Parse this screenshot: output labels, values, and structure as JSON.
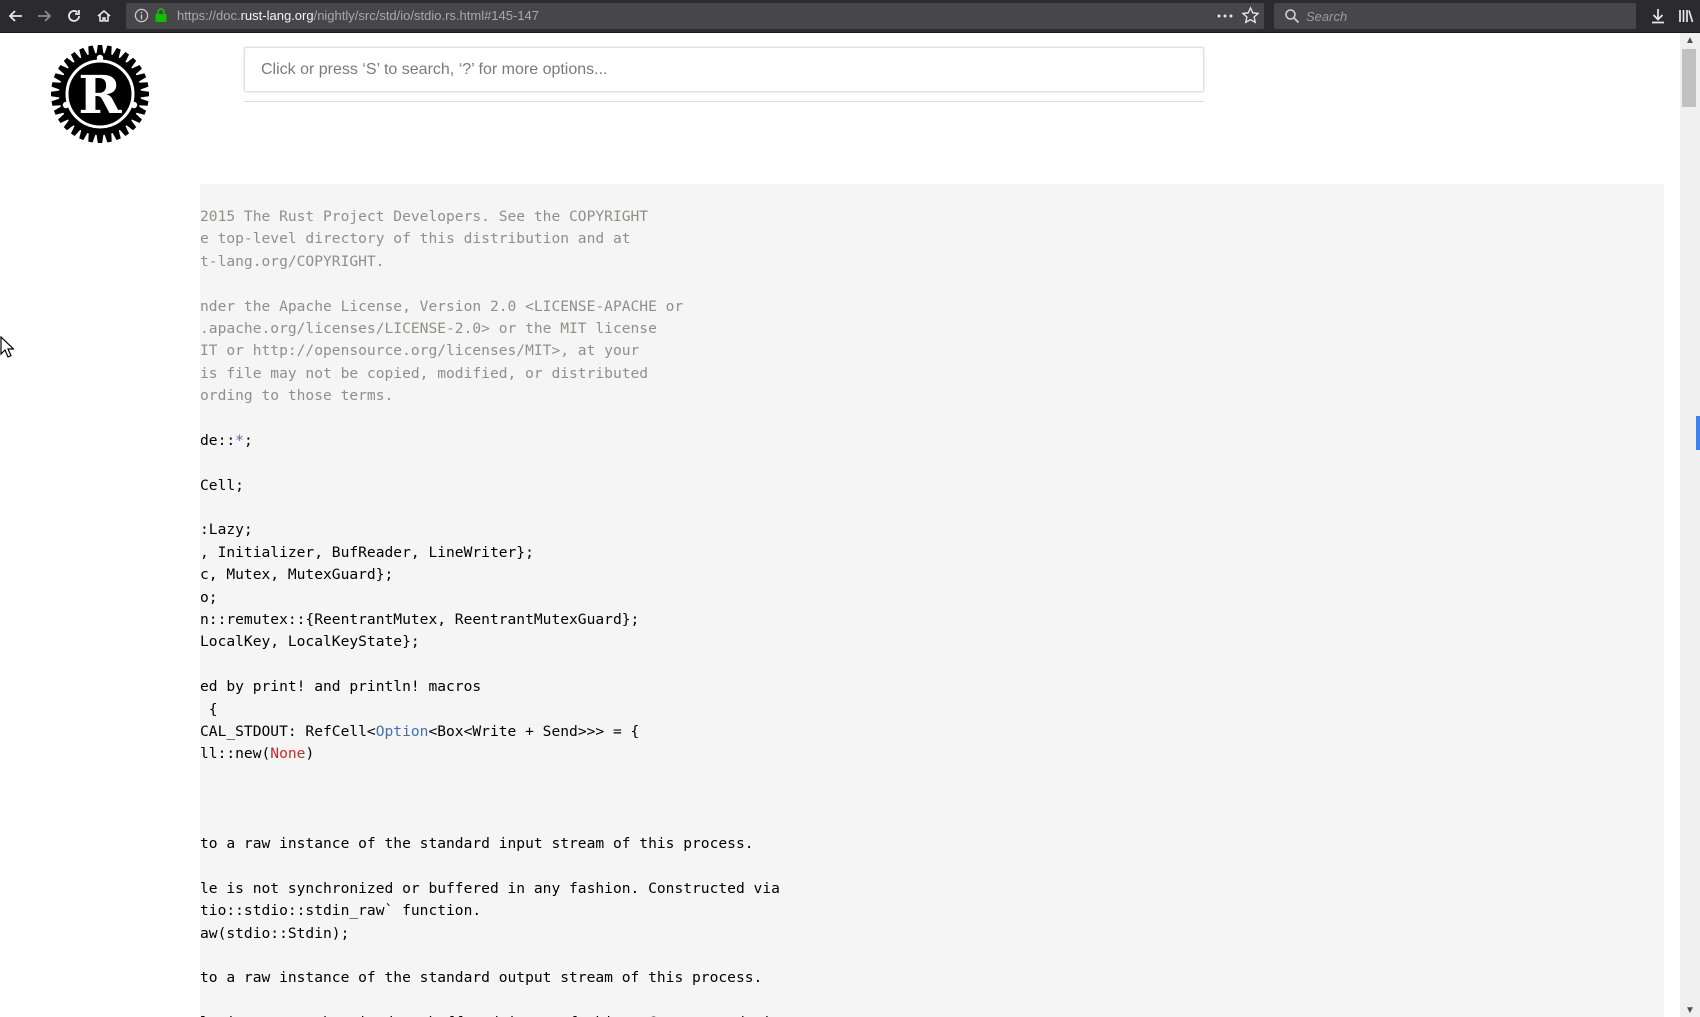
{
  "browser": {
    "url_prefix": "https://doc.",
    "url_host": "rust-lang.org",
    "url_path": "/nightly/src/std/io/stdio.rs.html#145-147",
    "search_placeholder": "Search",
    "icons": [
      "back-icon",
      "forward-icon",
      "reload-icon",
      "home-icon",
      "info-icon",
      "lock-icon",
      "more-icon",
      "bookmark-star-icon",
      "download-icon",
      "library-icon"
    ]
  },
  "page": {
    "search_placeholder": "Click or press ‘S’ to search, ‘?’ for more options...",
    "logo": "rust-logo"
  },
  "code_lines": [
    [
      {
        "t": "2015 The Rust Project Developers. See the COPYRIGHT",
        "c": "comment"
      }
    ],
    [
      {
        "t": "e top-level directory of this distribution and at",
        "c": "comment"
      }
    ],
    [
      {
        "t": "t-lang.org/COPYRIGHT.",
        "c": "comment"
      }
    ],
    [],
    [
      {
        "t": "nder the Apache License, Version 2.0 <LICENSE-APACHE or",
        "c": "comment"
      }
    ],
    [
      {
        "t": ".apache.org/licenses/LICENSE-2.0> or the MIT license",
        "c": "comment"
      }
    ],
    [
      {
        "t": "IT or http://opensource.org/licenses/MIT>, at your",
        "c": "comment"
      }
    ],
    [
      {
        "t": "is file may not be copied, modified, or distributed",
        "c": "comment"
      }
    ],
    [
      {
        "t": "ording to those terms.",
        "c": "comment"
      }
    ],
    [],
    [
      {
        "t": "de::",
        "c": ""
      },
      {
        "t": "*",
        "c": "kw-op"
      },
      {
        "t": ";",
        "c": ""
      }
    ],
    [],
    [
      {
        "t": "Cell;",
        "c": ""
      }
    ],
    [],
    [
      {
        "t": ":Lazy;",
        "c": ""
      }
    ],
    [
      {
        "t": ", Initializer, BufReader, LineWriter};",
        "c": ""
      }
    ],
    [
      {
        "t": "c, Mutex, MutexGuard};",
        "c": ""
      }
    ],
    [
      {
        "t": "o;",
        "c": ""
      }
    ],
    [
      {
        "t": "n::remutex::{ReentrantMutex, ReentrantMutexGuard};",
        "c": ""
      }
    ],
    [
      {
        "t": "LocalKey, LocalKeyState};",
        "c": ""
      }
    ],
    [],
    [
      {
        "t": "ed by print! and println! macros",
        "c": ""
      }
    ],
    [
      {
        "t": " {",
        "c": ""
      }
    ],
    [
      {
        "t": "CAL_STDOUT: RefCell<",
        "c": ""
      },
      {
        "t": "Option",
        "c": "type"
      },
      {
        "t": "<Box<Write + Send>>> = {",
        "c": ""
      }
    ],
    [
      {
        "t": "ll::new(",
        "c": ""
      },
      {
        "t": "None",
        "c": "const"
      },
      {
        "t": ")",
        "c": ""
      }
    ],
    [],
    [],
    [],
    [
      {
        "t": "to a raw instance of the standard input stream of this process.",
        "c": ""
      }
    ],
    [],
    [
      {
        "t": "le is not synchronized or buffered in any fashion. Constructed via",
        "c": ""
      }
    ],
    [
      {
        "t": "tio::stdio::stdin_raw` function.",
        "c": ""
      }
    ],
    [
      {
        "t": "aw(stdio::Stdin);",
        "c": ""
      }
    ],
    [],
    [
      {
        "t": "to a raw instance of the standard output stream of this process.",
        "c": ""
      }
    ],
    [],
    [
      {
        "t": "le is not synchronized or buffered in any fashion. Constructed via",
        "c": ""
      }
    ]
  ]
}
